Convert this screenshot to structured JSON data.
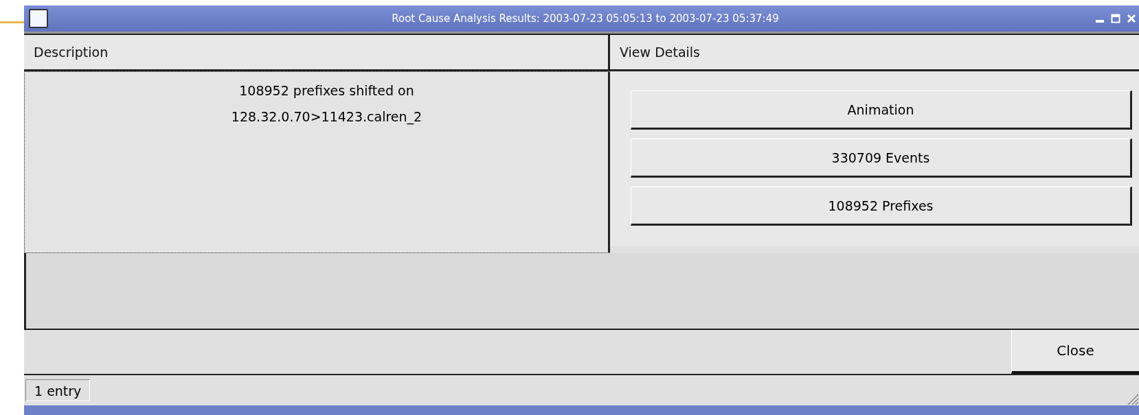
{
  "window": {
    "title": "Root Cause Analysis Results: 2003-07-23 05:05:13 to 2003-07-23 05:37:49"
  },
  "table": {
    "columns": [
      "Description",
      "View Details"
    ],
    "rows": [
      {
        "description": [
          "108952 prefixes shifted on",
          "128.32.0.70>11423.calren_2"
        ],
        "buttons": [
          "Animation",
          "330709 Events",
          "108952 Prefixes"
        ]
      }
    ]
  },
  "buttons": [
    "Close"
  ],
  "status_bar": {
    "text": "1 entry"
  }
}
